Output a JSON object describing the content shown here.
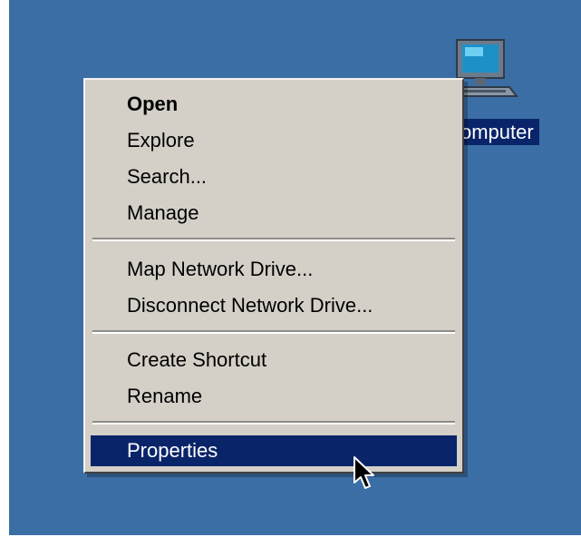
{
  "desktop": {
    "icon_label": "omputer",
    "icon_name": "computer-icon"
  },
  "context_menu": {
    "items": [
      {
        "label": "Open",
        "bold": true
      },
      {
        "label": "Explore"
      },
      {
        "label": "Search..."
      },
      {
        "label": "Manage"
      },
      {
        "label": "Map Network Drive..."
      },
      {
        "label": "Disconnect Network Drive..."
      },
      {
        "label": "Create Shortcut"
      },
      {
        "label": "Rename"
      },
      {
        "label": "Properties",
        "selected": true
      }
    ]
  },
  "colors": {
    "desktop_background": "#3b6ea5",
    "menu_background": "#d4d0c8",
    "selection": "#0a246a"
  }
}
